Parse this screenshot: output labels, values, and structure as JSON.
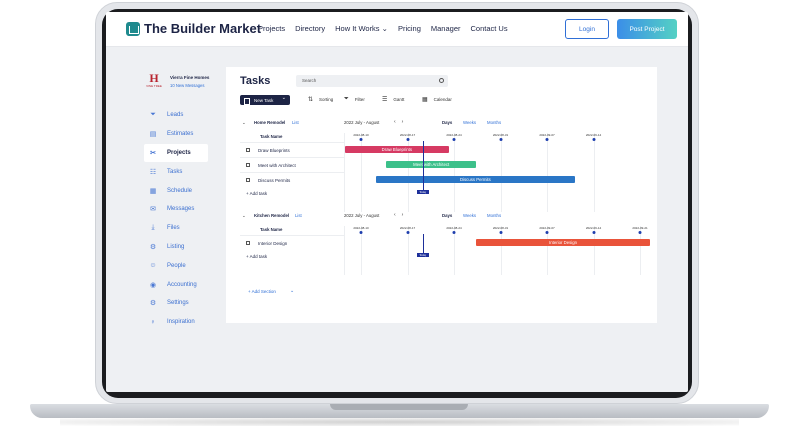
{
  "nav": {
    "brand": "The Builder Market",
    "links": [
      "Projects",
      "Directory",
      "How It Works",
      "Pricing",
      "Manager",
      "Contact Us"
    ],
    "login": "Login",
    "post_project": "Post Project"
  },
  "company": {
    "logo_letter": "H",
    "logo_sub": "VINE TREE",
    "name": "Vierra Fine Homes",
    "messages": "10 New Messages"
  },
  "sidebar": {
    "items": [
      {
        "label": "Leads",
        "icon": "funnel-icon"
      },
      {
        "label": "Estimates",
        "icon": "calculator-icon"
      },
      {
        "label": "Projects",
        "icon": "tools-icon",
        "active": true
      },
      {
        "label": "Tasks",
        "icon": "checklist-icon"
      },
      {
        "label": "Schedule",
        "icon": "calendar-icon"
      },
      {
        "label": "Messages",
        "icon": "envelope-icon"
      },
      {
        "label": "Files",
        "icon": "download-icon"
      },
      {
        "label": "Listing",
        "icon": "gear-icon"
      },
      {
        "label": "People",
        "icon": "people-icon"
      },
      {
        "label": "Accounting",
        "icon": "eye-icon"
      },
      {
        "label": "Settings",
        "icon": "settings-icon"
      },
      {
        "label": "Inspiration",
        "icon": "lightbulb-icon"
      }
    ]
  },
  "main": {
    "title": "Tasks",
    "search_placeholder": "Search",
    "new_task": "New Task",
    "sorting": "Sorting",
    "filter": "Filter",
    "gantt": "Gantt",
    "calendar": "Calendar",
    "add_section": "+ Add Section"
  },
  "groups": [
    {
      "name": "Home Remodel",
      "view": "List",
      "range": "2022 July - August",
      "views": [
        "Days",
        "Weeks",
        "Months"
      ],
      "column_header": "Task Name",
      "dates": [
        "2022-08-10",
        "2022-08-17",
        "2022-08-24",
        "2022-08-31",
        "2022-09-07",
        "2022-09-14"
      ],
      "tasks": [
        {
          "name": "Draw Blueprints",
          "start": 0.0,
          "end": 0.34,
          "color": "#d63a63"
        },
        {
          "name": "Meet with Architect",
          "start": 0.135,
          "end": 0.43,
          "color": "#3cc08a"
        },
        {
          "name": "Discuss Permits",
          "start": 0.1,
          "end": 0.755,
          "color": "#2a76c6"
        }
      ],
      "add_task": "+ Add task",
      "today_label": "Today",
      "today_pos": 0.255
    },
    {
      "name": "Kitchen Remodel",
      "view": "List",
      "range": "2022 July - August",
      "views": [
        "Days",
        "Weeks",
        "Months"
      ],
      "column_header": "Task Name",
      "dates": [
        "2022-08-10",
        "2022-08-17",
        "2022-08-24",
        "2022-08-31",
        "2022-09-07",
        "2022-09-14",
        "2022-09-21"
      ],
      "tasks": [
        {
          "name": "Interior Design",
          "start": 0.43,
          "end": 1.0,
          "color": "#e9533a"
        }
      ],
      "add_task": "+ Add task",
      "today_label": "Today",
      "today_pos": 0.255
    }
  ]
}
